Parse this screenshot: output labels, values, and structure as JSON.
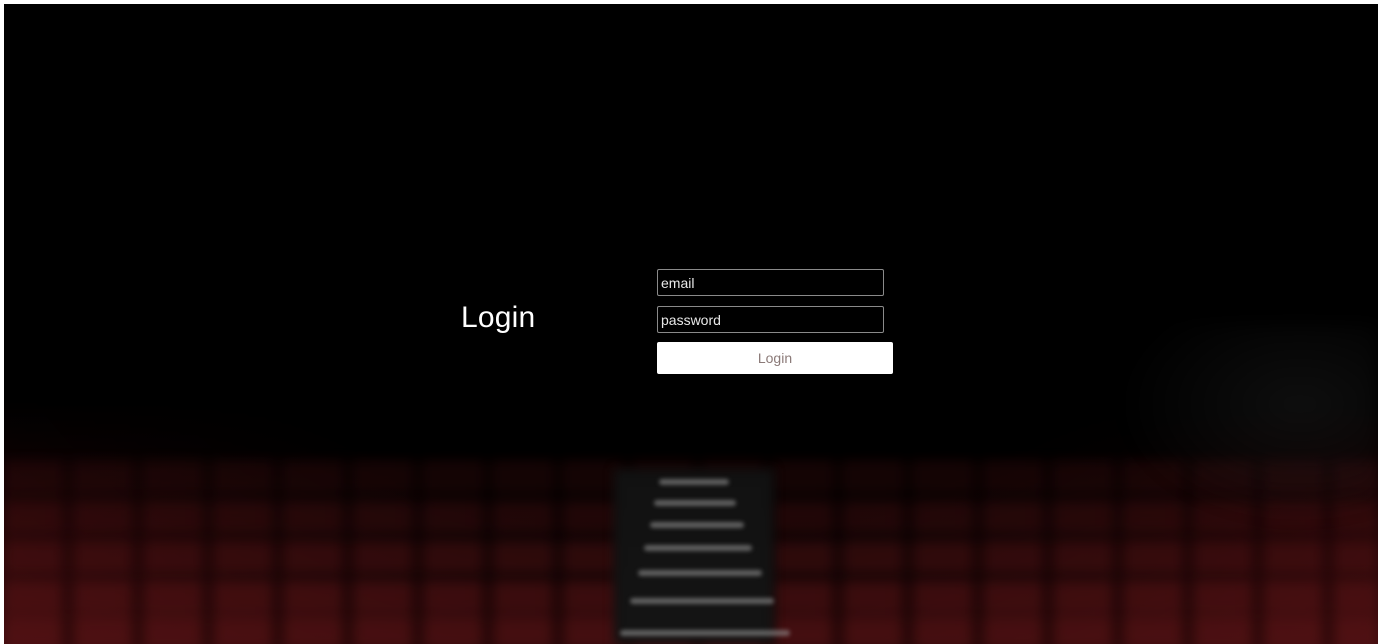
{
  "page": {
    "title": "Login"
  },
  "form": {
    "email_placeholder": "email",
    "email_value": "",
    "password_placeholder": "password",
    "password_value": "",
    "submit_label": "Login"
  },
  "colors": {
    "background": "#000000",
    "seat_red": "#5a1416",
    "button_bg": "#ffffff",
    "button_text": "#8b7a78",
    "field_border": "#8a8a8a"
  }
}
